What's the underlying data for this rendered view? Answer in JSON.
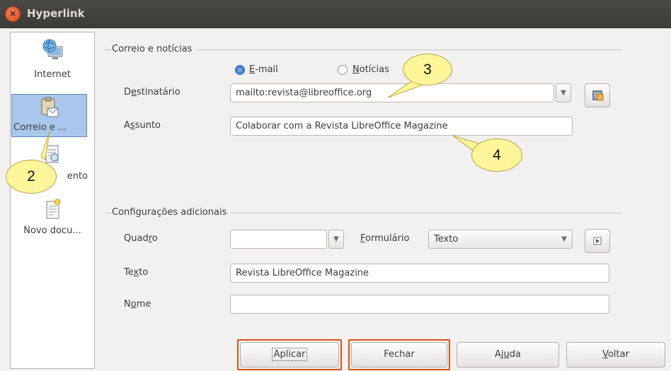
{
  "window": {
    "title": "Hyperlink",
    "close_glyph": "×"
  },
  "sidebar": {
    "items": [
      {
        "label": "Internet"
      },
      {
        "label": "Correio e ..."
      },
      {
        "label": "ento"
      },
      {
        "label": "Novo docu..."
      }
    ]
  },
  "mail_section": {
    "title": "Correio e notícias",
    "radio_email": {
      "label_prefix": "",
      "label_u": "E",
      "label_rest": "-mail"
    },
    "radio_news": {
      "label_u": "N",
      "label_rest": "otícias"
    },
    "recipient": {
      "label_a": "D",
      "label_u": "e",
      "label_b": "stinatário",
      "value": "mailto:revista@libreoffice.org"
    },
    "subject": {
      "label_a": "A",
      "label_u": "s",
      "label_b": "sunto",
      "value": "Colaborar com a Revista LibreOffice Magazine"
    }
  },
  "extra_section": {
    "title": "Configurações adicionais",
    "frame": {
      "label_a": "Quad",
      "label_u": "r",
      "label_b": "o",
      "value": ""
    },
    "form": {
      "label_u": "F",
      "label_rest": "ormulário",
      "value": "Texto"
    },
    "text": {
      "label_a": "Te",
      "label_u": "x",
      "label_b": "to",
      "value": "Revista LibreOffice Magazine"
    },
    "name": {
      "label_a": "N",
      "label_u": "o",
      "label_b": "me",
      "value": ""
    }
  },
  "buttons": {
    "apply": "Aplicar",
    "close": "Fechar",
    "help_a": "Aj",
    "help_u": "u",
    "help_b": "da",
    "back_u": "V",
    "back_rest": "oltar"
  },
  "callouts": {
    "c2": "2",
    "c3": "3",
    "c4": "4"
  },
  "colors": {
    "highlight": "#d9531e",
    "selection": "#a9c7ec",
    "callout": "#fff59a"
  }
}
